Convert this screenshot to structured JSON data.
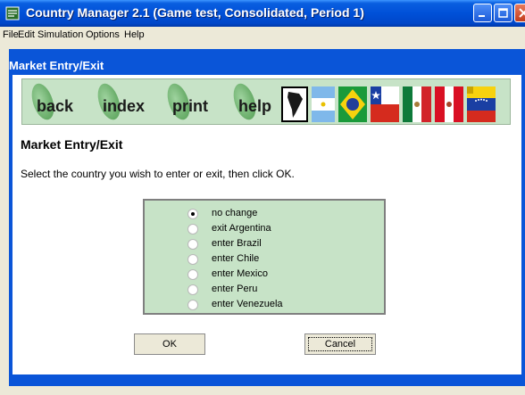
{
  "window": {
    "title": "Country Manager 2.1 (Game test, Consolidated, Period 1)"
  },
  "menu": [
    "File",
    "Edit",
    "Simulation",
    "Options",
    "Help"
  ],
  "dialog": {
    "title": "Market Entry/Exit",
    "nav": [
      "back",
      "index",
      "print",
      "help"
    ],
    "flags": [
      "south-america-map-icon",
      "argentina-flag-icon",
      "brazil-flag-icon",
      "chile-flag-icon",
      "mexico-flag-icon",
      "peru-flag-icon",
      "venezuela-flag-icon"
    ],
    "section_title": "Market Entry/Exit",
    "instruction": "Select the country you wish to enter or exit, then click OK.",
    "options": [
      "no change",
      "exit Argentina",
      "enter Brazil",
      "enter Chile",
      "enter Mexico",
      "enter Peru",
      "enter Venezuela"
    ],
    "selected_index": 0,
    "ok": "OK",
    "cancel": "Cancel"
  }
}
